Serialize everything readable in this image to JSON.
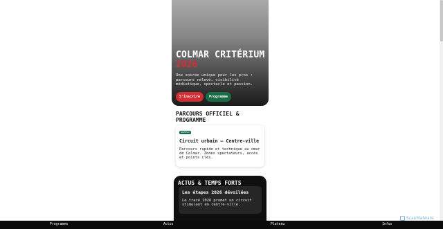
{
  "hero": {
    "title": "COLMAR CRITÉRIUM",
    "year": "2026",
    "description": "Une soirée unique pour les pros : parcours relevé, visibilité médiatique, spectacle et passion.",
    "register_label": "S'inscrire",
    "programme_label": "Programme"
  },
  "course": {
    "section_title": "PARCOURS OFFICIEL & PROGRAMME",
    "badge": "NOUVEAU",
    "card_title": "Circuit urbain — Centre-ville",
    "card_body": "Parcours rapide et technique au cœur de Colmar. Zones spectateurs, accès et points clés."
  },
  "news": {
    "section_title": "ACTUS & TEMPS FORTS",
    "card_title": "Les étapes 2026 dévoilées",
    "card_body": "Le tracé 2026 promet un circuit stimulant en centre-ville."
  },
  "bottom_nav": {
    "programme": "Programme",
    "actus": "Actus",
    "plateau": "Plateau",
    "infos": "Infos"
  },
  "watermark": "ScanMalware"
}
